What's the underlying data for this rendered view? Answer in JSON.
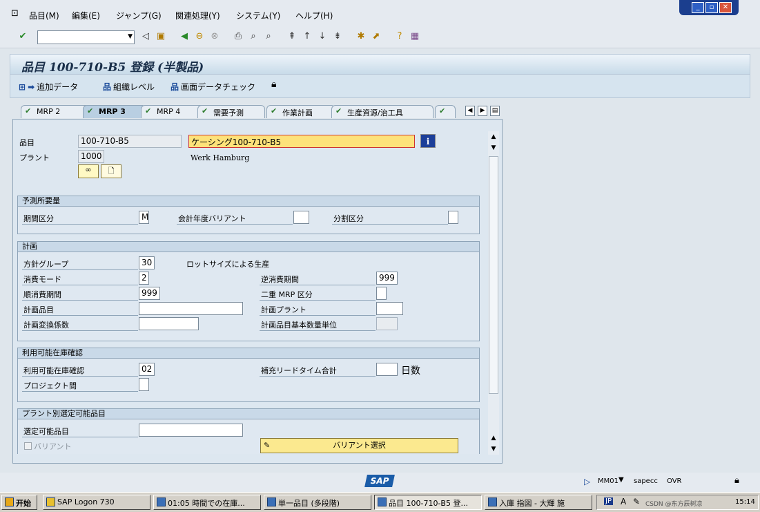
{
  "menubar": {
    "items": [
      "品目(M)",
      "編集(E)",
      "ジャンプ(G)",
      "関連処理(Y)",
      "システム(Y)",
      "ヘルプ(H)"
    ]
  },
  "command_field": {
    "value": ""
  },
  "title": "品目 100-710-B5 登録 (半製品)",
  "app_toolbar": {
    "additional_data": "追加データ",
    "org_levels": "組織レベル",
    "check_screen_data": "画面データチェック"
  },
  "tabs": [
    "MRP 2",
    "MRP 3",
    "MRP 4",
    "需要予測",
    "作業計画",
    "生産資源/治工具"
  ],
  "active_tab": "MRP 3",
  "header": {
    "material_label": "品目",
    "material_value": "100-710-B5",
    "material_desc": "ケーシング100-710-B5",
    "plant_label": "プラント",
    "plant_value": "1000",
    "plant_desc": "Werk Hamburg"
  },
  "forecast": {
    "title": "予測所要量",
    "period_label": "期間区分",
    "period_value": "M",
    "fiscal_variant_label": "会計年度バリアント",
    "fiscal_variant_value": "",
    "split_label": "分割区分",
    "split_value": ""
  },
  "planning": {
    "title": "計画",
    "strategy_group_label": "方針グループ",
    "strategy_group_value": "30",
    "strategy_group_desc": "ロットサイズによる生産",
    "consumption_mode_label": "消費モード",
    "consumption_mode_value": "2",
    "bwd_period_label": "逆消費期間",
    "bwd_period_value": "999",
    "fwd_period_label": "順消費期間",
    "fwd_period_value": "999",
    "mixed_mrp_label": "二重 MRP 区分",
    "mixed_mrp_value": "",
    "planning_material_label": "計画品目",
    "planning_material_value": "",
    "planning_plant_label": "計画プラント",
    "planning_plant_value": "",
    "conv_factor_label": "計画変換係数",
    "conv_factor_value": "",
    "base_uom_label": "計画品目基本数量単位",
    "base_uom_value": ""
  },
  "availability": {
    "title": "利用可能在庫確認",
    "check_label": "利用可能在庫確認",
    "check_value": "02",
    "rlt_label": "補充リードタイム合計",
    "rlt_value": "",
    "rlt_unit": "日数",
    "cross_project_label": "プロジェクト間",
    "cross_project_value": ""
  },
  "plant_specific": {
    "title": "プラント別選定可能品目",
    "configurable_label": "選定可能品目",
    "configurable_value": "",
    "variant_label": "バリアント",
    "variant_select_btn": "バリアント選択"
  },
  "status": {
    "transaction": "MM01",
    "server": "sapecc",
    "mode": "OVR",
    "logo": "SAP"
  },
  "taskbar": {
    "start": "开始",
    "tasks": [
      "SAP Logon 730",
      "01:05 時間での在庫...",
      "単一品目 (多段階)",
      "品目 100-710-B5 登...",
      "入庫 指図 - 大輝 施"
    ],
    "lang": "JP",
    "clock": "15:14",
    "watermark": "CSDN @东方辰树凉"
  }
}
